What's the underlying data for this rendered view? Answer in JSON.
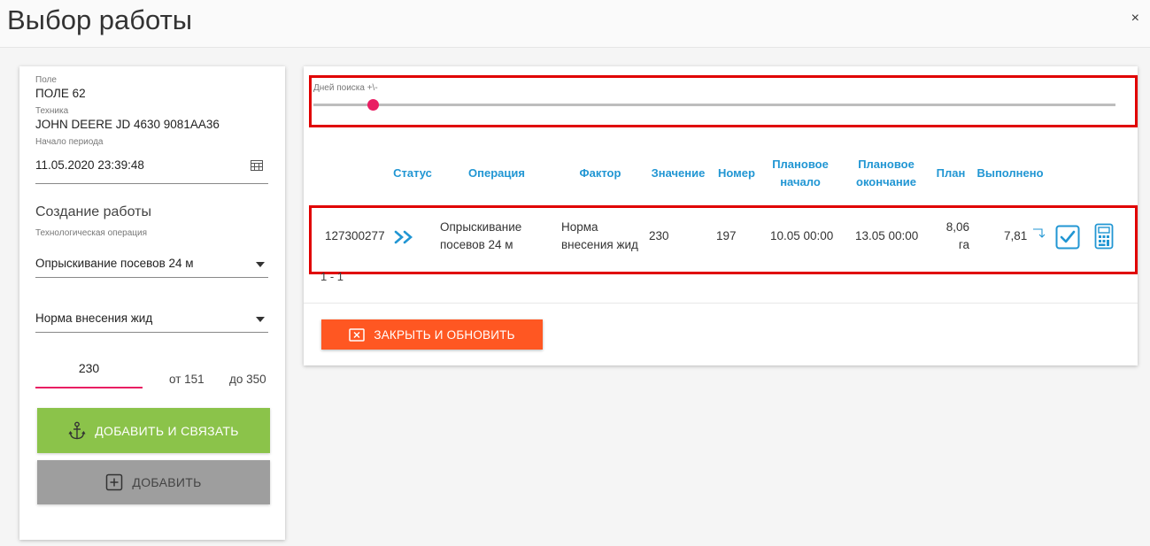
{
  "dialog": {
    "title": "Выбор работы",
    "close_symbol": "×"
  },
  "left": {
    "field_label": "Поле",
    "field_value": "ПОЛЕ 62",
    "machine_label": "Техника",
    "machine_value": "JOHN DEERE JD 4630 9081АА36",
    "period_label": "Начало периода",
    "period_value": "11.05.2020 23:39:48",
    "section_title": "Создание работы",
    "operation_label": "Технологическая операция",
    "operation_value": "Опрыскивание посевов 24 м",
    "factor_value": "Норма внесения жид",
    "amount_value": "230",
    "range_from": "от 151",
    "range_to": "до 350",
    "add_link_button": "ДОБАВИТЬ И СВЯЗАТЬ",
    "add_button": "ДОБАВИТЬ",
    "icons": [
      "calendar-icon",
      "dropdown-arrow-icon",
      "anchor-icon",
      "plus-square-icon"
    ]
  },
  "right": {
    "slider": {
      "label": "Дней поиска +\\-",
      "value_fraction": 0.074
    },
    "columns": [
      "Статус",
      "Операция",
      "Фактор",
      "Значение",
      "Номер",
      "Плановое начало",
      "Плановое окончание",
      "План",
      "Выполнено"
    ],
    "row": {
      "id": "127300277",
      "status_icon": "double-chevron-right-icon",
      "operation": "Опрыскивание посевов 24 м",
      "factor": "Норма внесения жид",
      "value": "230",
      "number": "197",
      "plan_start": "10.05 00:00",
      "plan_end": "13.05 00:00",
      "plan": "8,06 га",
      "done": "7,81"
    },
    "pager": "1 - 1",
    "close_refresh_button": "ЗАКРЫТЬ И ОБНОВИТЬ",
    "icons": [
      "return-arrow-icon",
      "checkbox-icon",
      "calculator-icon",
      "close-box-icon"
    ]
  },
  "colors": {
    "accent_blue": "#2196d3",
    "pink": "#e91e63",
    "green_button": "#8bc34a",
    "gray_button": "#9e9e9e",
    "orange_button": "#ff5722",
    "highlight_red": "#e00000"
  }
}
